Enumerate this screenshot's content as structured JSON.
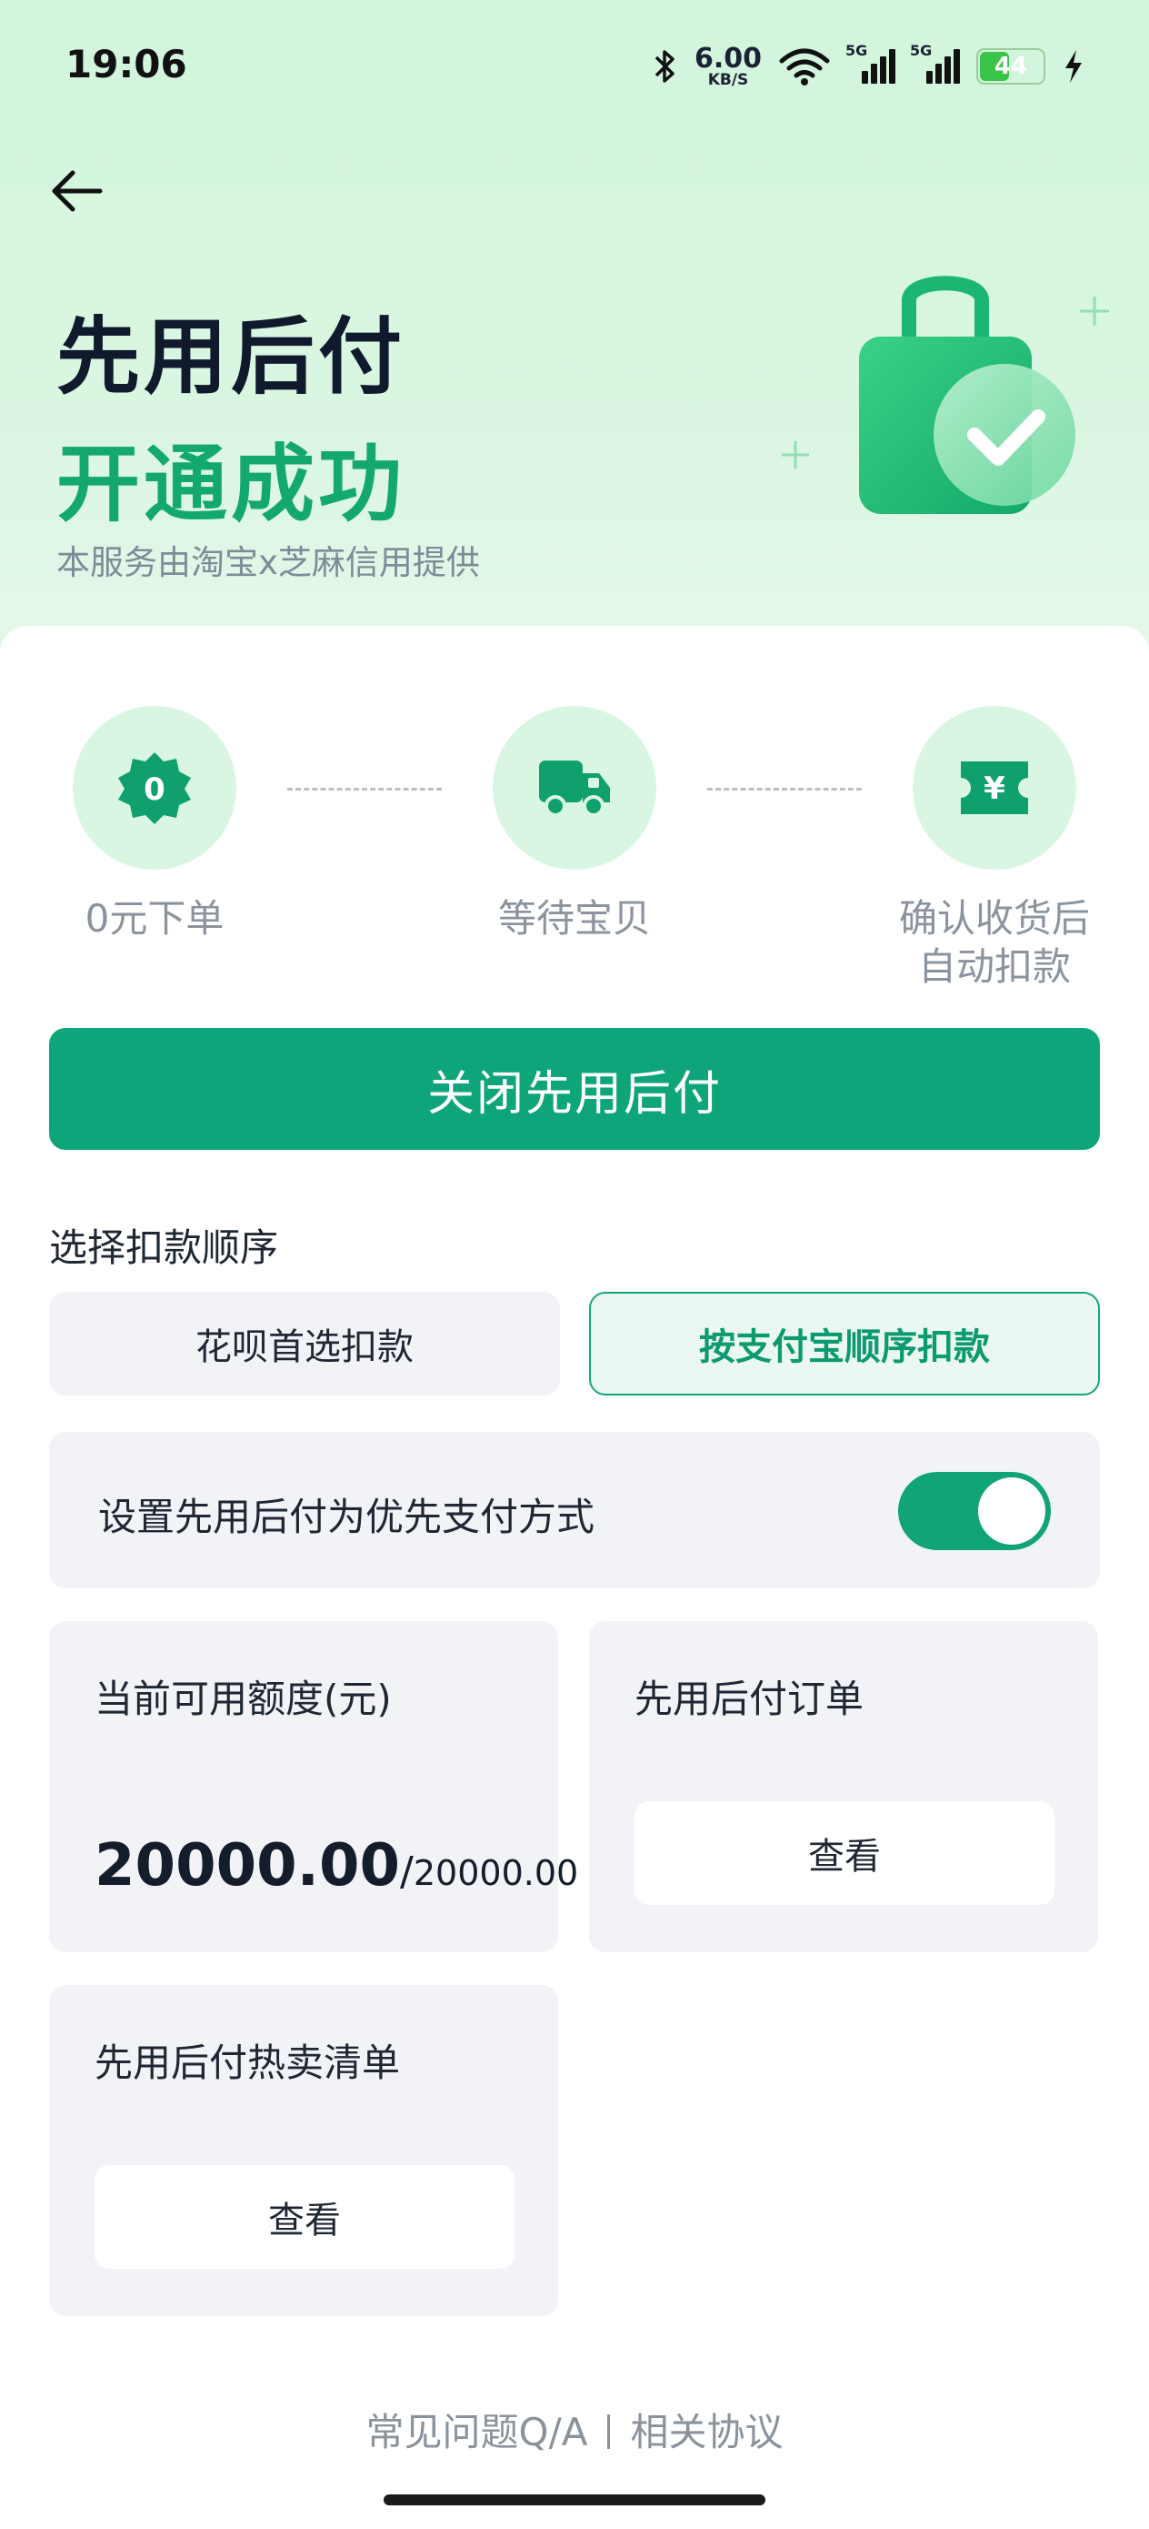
{
  "status_bar": {
    "time": "19:06",
    "net_speed_value": "6.00",
    "net_speed_unit": "KB/S",
    "signal1_tag": "5G",
    "signal2_tag": "5G",
    "battery": "44",
    "icons": [
      "bluetooth-icon",
      "wifi-icon",
      "signal-icon",
      "battery-icon",
      "charging-icon"
    ]
  },
  "header": {
    "title_line1": "先用后付",
    "title_line2": "开通成功",
    "provider": "本服务由淘宝x芝麻信用提供"
  },
  "steps": [
    {
      "icon": "zero-badge-icon",
      "badge_text": "0",
      "label": "0元下单"
    },
    {
      "icon": "truck-icon",
      "label": "等待宝贝"
    },
    {
      "icon": "yuan-ticket-icon",
      "badge_text": "¥",
      "label_line1": "确认收货后",
      "label_line2": "自动扣款"
    }
  ],
  "close_button": "关闭先用后付",
  "payment_order": {
    "label": "选择扣款顺序",
    "options": [
      {
        "label": "花呗首选扣款",
        "selected": false
      },
      {
        "label": "按支付宝顺序扣款",
        "selected": true
      }
    ]
  },
  "priority_setting": {
    "label": "设置先用后付为优先支付方式",
    "enabled": true
  },
  "credit_card": {
    "title": "当前可用额度(元)",
    "available": "20000.00",
    "separator": "/",
    "total": "20000.00"
  },
  "orders_card": {
    "title": "先用后付订单",
    "button": "查看"
  },
  "hot_list_card": {
    "title": "先用后付热卖清单",
    "button": "查看"
  },
  "footer": {
    "faq": "常见问题Q/A",
    "agreement": "相关协议"
  },
  "colors": {
    "brand_green": "#0ea57a",
    "title_green": "#13a86e",
    "hero_bg": "#d2f5dc"
  }
}
